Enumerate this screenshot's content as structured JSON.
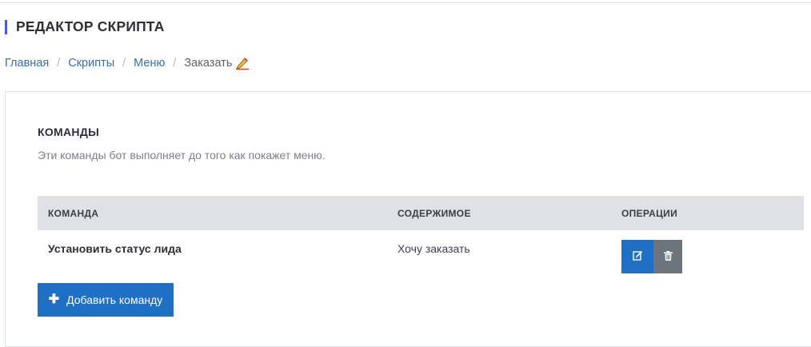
{
  "header": {
    "title": "РЕДАКТОР СКРИПТА",
    "accent_color": "#4a5ad7"
  },
  "breadcrumb": {
    "items": [
      {
        "label": "Главная"
      },
      {
        "label": "Скрипты"
      },
      {
        "label": "Меню"
      }
    ],
    "separator": "/",
    "current": "Заказать",
    "current_icon": "writing-hand-icon"
  },
  "commands_section": {
    "title": "КОМАНДЫ",
    "description": "Эти команды бот выполняет до того как покажет меню.",
    "table": {
      "columns": [
        "КОМАНДА",
        "СОДЕРЖИМОЕ",
        "ОПЕРАЦИИ"
      ],
      "rows": [
        {
          "command": "Установить статус лида",
          "content": "Хочу заказать",
          "operations": [
            "edit-icon",
            "trash-icon"
          ]
        }
      ]
    },
    "add_button_label": "Добавить команду",
    "add_button_icon": "plus-icon"
  },
  "colors": {
    "primary": "#1f6fc5",
    "secondary": "#6c757d",
    "link": "#2e6fbf"
  }
}
